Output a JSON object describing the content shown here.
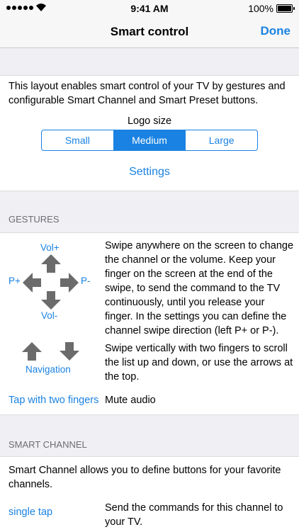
{
  "status_bar": {
    "time": "9:41 AM",
    "battery": "100%"
  },
  "nav": {
    "title": "Smart control",
    "done": "Done"
  },
  "intro": {
    "description": "This layout enables smart control of your TV by gestures and configurable Smart Channel and Smart Preset buttons.",
    "logo_size_label": "Logo size",
    "logo_size_options": [
      "Small",
      "Medium",
      "Large"
    ],
    "logo_size_selected": "Medium",
    "settings_link": "Settings"
  },
  "gestures": {
    "header": "GESTURES",
    "labels": {
      "vol_up": "Vol+",
      "vol_down": "Vol-",
      "p_plus": "P+",
      "p_minus": "P-",
      "navigation": "Navigation"
    },
    "swipe_text": "Swipe anywhere on the screen to change the channel or the volume. Keep your finger on the screen at the end of the swipe, to send the command to the TV continuously, until you release your finger. In the settings you can define the channel swipe direction (left P+ or P-).",
    "two_finger_text": "Swipe vertically with two fingers to scroll the list up and down, or use the arrows at the top.",
    "tap_label": "Tap with two fingers",
    "tap_action": "Mute audio"
  },
  "smart_channel": {
    "header": "SMART CHANNEL",
    "description": "Smart Channel allows you to define buttons for your favorite channels.",
    "single_tap_label": "single tap",
    "single_tap_text": "Send the commands for this channel to your TV."
  },
  "colors": {
    "accent": "#1a82e2",
    "arrow": "#6b6b6b",
    "background": "#efeff4"
  }
}
